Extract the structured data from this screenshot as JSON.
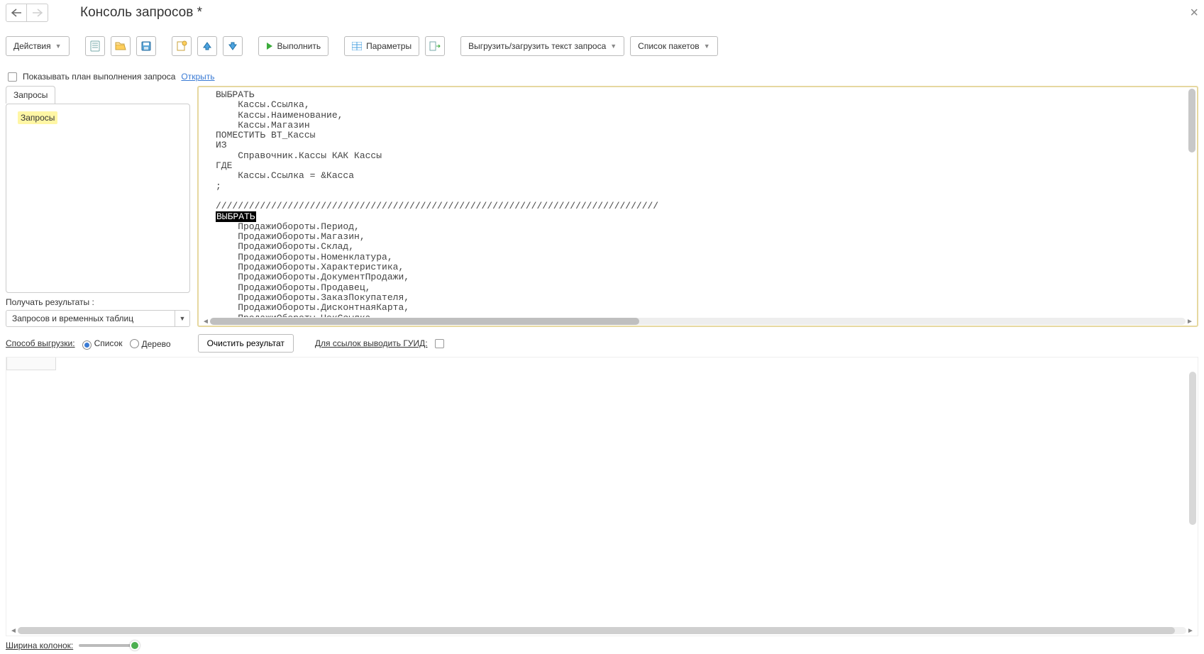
{
  "title": "Консоль запросов *",
  "toolbar": {
    "actions_label": "Действия",
    "execute_label": "Выполнить",
    "params_label": "Параметры",
    "export_label": "Выгрузить/загрузить текст запроса",
    "packets_label": "Список пакетов"
  },
  "plan": {
    "show_plan_label": "Показывать план выполнения запроса",
    "open_label": "Открыть"
  },
  "tabs": {
    "queries_label": "Запросы"
  },
  "tree": {
    "root_label": "Запросы"
  },
  "results": {
    "label": "Получать результаты :",
    "value": "Запросов и временных таблиц"
  },
  "code": {
    "l1": "ВЫБРАТЬ",
    "l2": "    Кассы.Ссылка,",
    "l3": "    Кассы.Наименование,",
    "l4": "    Кассы.Магазин",
    "l5": "ПОМЕСТИТЬ ВТ_Кассы",
    "l6": "ИЗ",
    "l7": "    Справочник.Кассы КАК Кассы",
    "l8": "ГДЕ",
    "l9": "    Кассы.Ссылка = &Касса",
    "l10": ";",
    "l11": "",
    "l12": "////////////////////////////////////////////////////////////////////////////////",
    "l13": "ВЫБРАТЬ",
    "l14": "    ПродажиОбороты.Период,",
    "l15": "    ПродажиОбороты.Магазин,",
    "l16": "    ПродажиОбороты.Склад,",
    "l17": "    ПродажиОбороты.Номенклатура,",
    "l18": "    ПродажиОбороты.Характеристика,",
    "l19": "    ПродажиОбороты.ДокументПродажи,",
    "l20": "    ПродажиОбороты.Продавец,",
    "l21": "    ПродажиОбороты.ЗаказПокупателя,",
    "l22": "    ПродажиОбороты.ДисконтнаяКарта,",
    "l23": "    ПродажиОбороты.ЧекСсылка,"
  },
  "method": {
    "label": "Способ выгрузки:",
    "list": "Список",
    "tree": "Дерево",
    "clear": "Очистить результат",
    "guid": "Для ссылок выводить ГУИД:"
  },
  "footer": {
    "width_label": "Ширина колонок:"
  }
}
